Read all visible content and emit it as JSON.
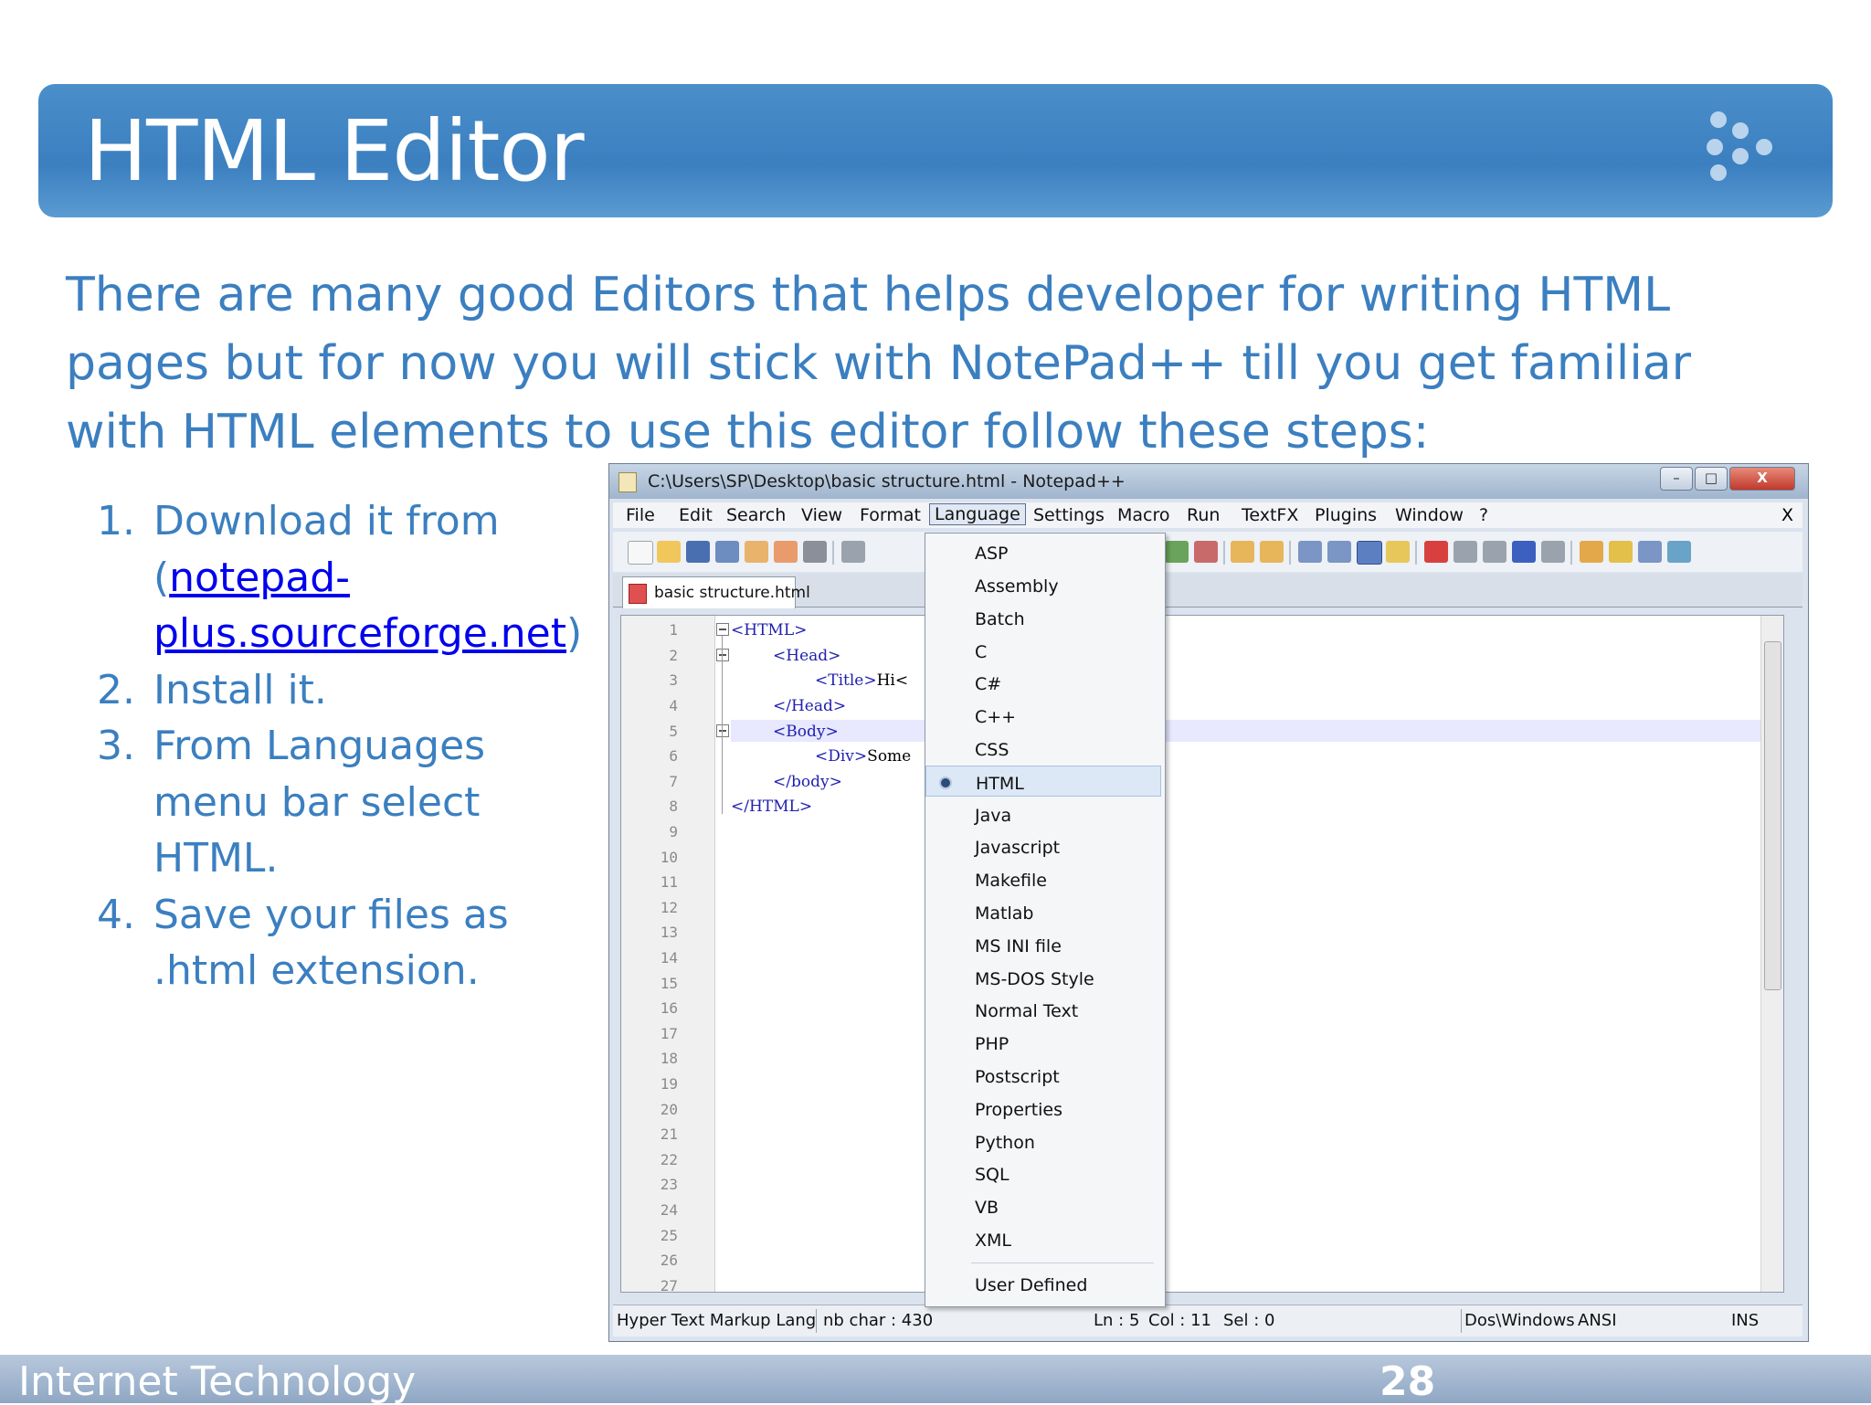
{
  "slide": {
    "title": "HTML Editor",
    "intro": "There are many good Editors that helps developer for writing HTML pages but for now you will stick with NotePad++ till you get familiar with HTML elements to use this editor follow these steps:",
    "steps": [
      {
        "num": "1.",
        "pre": "Download it from (",
        "link": "notepad-plus.sourceforge.net",
        "post": ")"
      },
      {
        "num": "2.",
        "text": "Install it."
      },
      {
        "num": "3.",
        "text": "From Languages menu bar select HTML."
      },
      {
        "num": "4.",
        "text": "Save your files as .html extension."
      }
    ],
    "footer_left": "Internet Technology",
    "page_number": "28"
  },
  "window": {
    "title": "C:\\Users\\SP\\Desktop\\basic structure.html - Notepad++",
    "controls": {
      "minimize": "–",
      "maximize": "□",
      "close": "X"
    },
    "menu": [
      "File",
      "Edit",
      "Search",
      "View",
      "Format",
      "Language",
      "Settings",
      "Macro",
      "Run",
      "TextFX",
      "Plugins",
      "Window",
      "?"
    ],
    "menu_close": "X",
    "tab_label": "basic structure.html",
    "line_numbers": [
      "1",
      "2",
      "3",
      "4",
      "5",
      "6",
      "7",
      "8",
      "9",
      "10",
      "11",
      "12",
      "13",
      "14",
      "15",
      "16",
      "17",
      "18",
      "19",
      "20",
      "21",
      "22",
      "23",
      "24",
      "25",
      "26",
      "27"
    ],
    "code": {
      "l1": "<HTML>",
      "l2": "<Head>",
      "l3_tag": "<Title>",
      "l3_text": "Hi<",
      "l4": "</Head>",
      "l5": "<Body>",
      "l6_tag": "<Div>",
      "l6_text": "Some",
      "l7": "</body>",
      "l8": "</HTML>"
    },
    "status": {
      "type": "Hyper Text Markup Lang",
      "chars": "nb char : 430",
      "ln": "Ln : 5",
      "col": "Col : 11",
      "sel": "Sel : 0",
      "eol": "Dos\\Windows",
      "enc": "ANSI",
      "mode": "INS"
    },
    "language_menu": {
      "items": [
        "ASP",
        "Assembly",
        "Batch",
        "C",
        "C#",
        "C++",
        "CSS",
        "HTML",
        "Java",
        "Javascript",
        "Makefile",
        "Matlab",
        "MS INI file",
        "MS-DOS Style",
        "Normal Text",
        "PHP",
        "Postscript",
        "Properties",
        "Python",
        "SQL",
        "VB",
        "XML"
      ],
      "selected": "HTML",
      "extra": "User Defined"
    }
  },
  "colors": {
    "accent": "#3b7fc0",
    "title_bar": "#4a8fca",
    "link": "#0000ee",
    "tag": "#2020b0"
  }
}
